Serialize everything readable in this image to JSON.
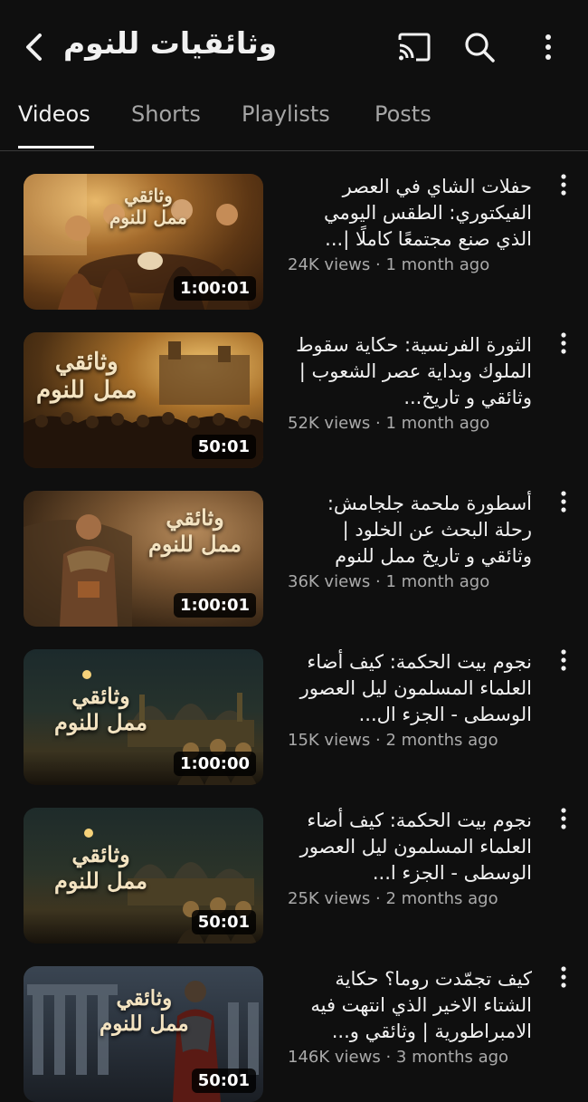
{
  "header": {
    "title": "وثائقيات للنوم",
    "icons": [
      "back-arrow-icon",
      "cast-icon",
      "search-icon",
      "more-vertical-icon"
    ]
  },
  "tabs": [
    {
      "label": "Videos",
      "active": true
    },
    {
      "label": "Shorts",
      "active": false
    },
    {
      "label": "Playlists",
      "active": false
    },
    {
      "label": "Posts",
      "active": false
    }
  ],
  "videos": [
    {
      "title": "حفلات الشاي في العصر الفيكتوري: الطقس اليومي الذي صنع مجتمعًا كاملًا |...",
      "views": "24K views",
      "age": "1 month ago",
      "duration": "1:00:01",
      "thumb_caption_1": "وثائقي",
      "thumb_caption_2": "ممل للنوم"
    },
    {
      "title": "الثورة الفرنسية: حكاية سقوط الملوك وبداية عصر الشعوب | وثائقي و تاريخ...",
      "views": "52K views",
      "age": "1 month ago",
      "duration": "50:01",
      "thumb_caption_1": "وثائقي",
      "thumb_caption_2": "ممل للنوم"
    },
    {
      "title": "أسطورة ملحمة جلجامش: رحلة البحث عن الخلود | وثائقي و تاريخ ممل للنوم",
      "views": "36K views",
      "age": "1 month ago",
      "duration": "1:00:01",
      "thumb_caption_1": "وثائقي",
      "thumb_caption_2": "ممل للنوم"
    },
    {
      "title": "نجوم بيت الحكمة: كيف أضاء العلماء المسلمون ليل العصور الوسطى - الجزء ال...",
      "views": "15K views",
      "age": "2 months ago",
      "duration": "1:00:00",
      "thumb_caption_1": "وثائقي",
      "thumb_caption_2": "ممل للنوم"
    },
    {
      "title": "نجوم بيت الحكمة: كيف أضاء العلماء المسلمون ليل العصور الوسطى - الجزء ا...",
      "views": "25K views",
      "age": "2 months ago",
      "duration": "50:01",
      "thumb_caption_1": "وثائقي",
      "thumb_caption_2": "ممل للنوم"
    },
    {
      "title": "كيف تجمّدت روما؟ حكاية الشتاء الاخير الذي انتهت فيه الامبراطورية | وثائقي و...",
      "views": "146K views",
      "age": "3 months ago",
      "duration": "50:01",
      "thumb_caption_1": "وثائقي",
      "thumb_caption_2": "ممل للنوم"
    }
  ],
  "colors": {
    "background": "#0f0f0f",
    "text": "#f1f1f1",
    "muted": "#aaaaaa"
  }
}
